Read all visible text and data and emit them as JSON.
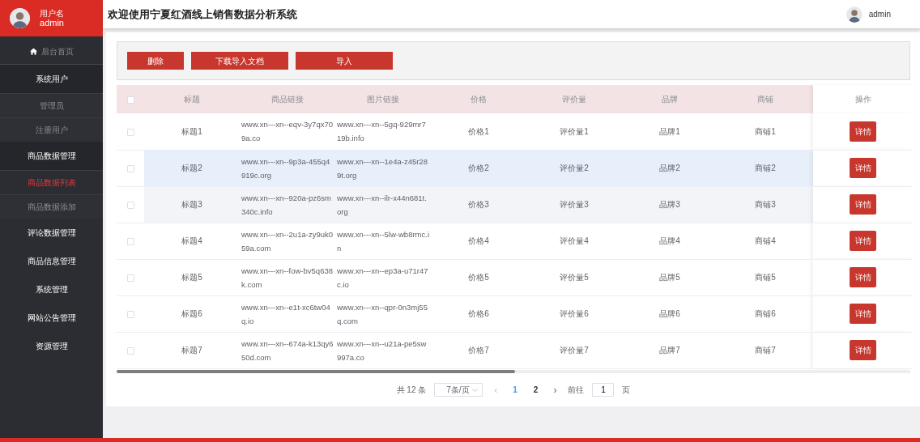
{
  "sidebar": {
    "user_label": "用户名",
    "user_name": "admin",
    "items": [
      {
        "label": "后台首页",
        "kind": "home"
      },
      {
        "label": "系统用户",
        "kind": "group",
        "children": [
          {
            "label": "管理员",
            "selected": false
          },
          {
            "label": "注册用户",
            "selected": false
          }
        ]
      },
      {
        "label": "商品数据管理",
        "kind": "group",
        "children": [
          {
            "label": "商品数据列表",
            "selected": true
          },
          {
            "label": "商品数据添加",
            "selected": false
          }
        ]
      },
      {
        "label": "评论数据管理",
        "kind": "group"
      },
      {
        "label": "商品信息管理",
        "kind": "group"
      },
      {
        "label": "系统管理",
        "kind": "group"
      },
      {
        "label": "网站公告管理",
        "kind": "group"
      },
      {
        "label": "资源管理",
        "kind": "group"
      }
    ]
  },
  "header": {
    "title": "欢迎使用宁夏红酒线上销售数据分析系统",
    "user_name": "admin"
  },
  "toolbar": {
    "buttons": [
      "删除",
      "下载导入文档",
      "导入"
    ]
  },
  "table": {
    "select_all_checked": false,
    "columns": [
      "标题",
      "商品链接",
      "图片链接",
      "价格",
      "评价量",
      "品牌",
      "商铺",
      "操作"
    ],
    "rows": [
      {
        "checked": false,
        "kind": "plain",
        "cells": [
          "标题1",
          "www.xn---xn--eqv-3y7qx709a.co",
          "www.xn---xn--5gq-929mr719b.info",
          "价格1",
          "评价量1",
          "品牌1",
          "商铺1"
        ],
        "action": "详情"
      },
      {
        "checked": false,
        "kind": "hovered",
        "cells": [
          "标题2",
          "www.xn---xn--9p3a-455q4919c.org",
          "www.xn---xn--1e4a-z45r289t.org",
          "价格2",
          "评价量2",
          "品牌2",
          "商铺2"
        ],
        "action": "详情"
      },
      {
        "checked": false,
        "kind": "striped",
        "cells": [
          "标题3",
          "www.xn---xn--920a-pz6sm340c.info",
          "www.xn---xn--ilr-x44n681t.org",
          "价格3",
          "评价量3",
          "品牌3",
          "商铺3"
        ],
        "action": "详情"
      },
      {
        "checked": false,
        "kind": "plain",
        "cells": [
          "标题4",
          "www.xn---xn--2u1a-zy9uk059a.com",
          "www.xn---xn--5lw-wb8rmc.in",
          "价格4",
          "评价量4",
          "品牌4",
          "商铺4"
        ],
        "action": "详情"
      },
      {
        "checked": false,
        "kind": "plain",
        "cells": [
          "标题5",
          "www.xn---xn--fow-bv5q638k.com",
          "www.xn---xn--ep3a-u71r47c.io",
          "价格5",
          "评价量5",
          "品牌5",
          "商铺5"
        ],
        "action": "详情"
      },
      {
        "checked": false,
        "kind": "plain",
        "cells": [
          "标题6",
          "www.xn---xn--e1t-xc6tw04q.io",
          "www.xn---xn--qpr-0n3mj55q.com",
          "价格6",
          "评价量6",
          "品牌6",
          "商铺6"
        ],
        "action": "详情"
      },
      {
        "checked": false,
        "kind": "plain",
        "cells": [
          "标题7",
          "www.xn---xn--674a-k13qy650d.com",
          "www.xn---xn--u21a-pe5sw997a.co",
          "价格7",
          "评价量7",
          "品牌7",
          "商铺7"
        ],
        "action": "详情"
      }
    ]
  },
  "pagination": {
    "total": "共 12 条",
    "page_size": "7条/页",
    "prev": "‹",
    "pages": [
      {
        "label": "1",
        "selected": true
      },
      {
        "label": "2",
        "selected": false
      }
    ],
    "next": "›",
    "goto_label": "前往",
    "goto_value": "1",
    "goto_suffix": "页"
  }
}
